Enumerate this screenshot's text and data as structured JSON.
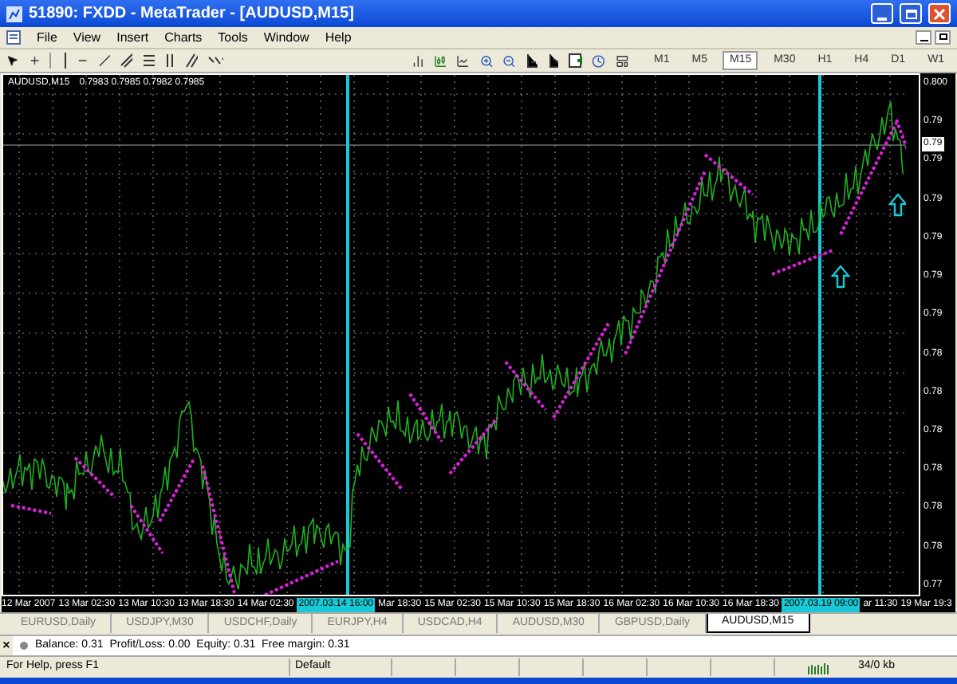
{
  "window": {
    "title": "51890: FXDD - MetaTrader - [AUDUSD,M15]"
  },
  "menu": [
    "File",
    "View",
    "Insert",
    "Charts",
    "Tools",
    "Window",
    "Help"
  ],
  "timeframes": [
    {
      "label": "M1",
      "selected": false
    },
    {
      "label": "M5",
      "selected": false
    },
    {
      "label": "M15",
      "selected": true
    },
    {
      "label": "M30",
      "selected": false
    },
    {
      "label": "H1",
      "selected": false
    },
    {
      "label": "H4",
      "selected": false
    },
    {
      "label": "D1",
      "selected": false
    },
    {
      "label": "W1",
      "selected": false
    }
  ],
  "chart": {
    "symbol": "AUDUSD,M15",
    "quotes": "0.7983 0.7985 0.7982 0.7985",
    "current_price": "0.79",
    "price_axis": [
      "0.800",
      "0.79",
      "0.79",
      "0.79",
      "0.79",
      "0.79",
      "0.79",
      "0.78",
      "0.78",
      "0.78",
      "0.78",
      "0.78",
      "0.78",
      "0.77"
    ],
    "time_axis": [
      {
        "label": "12 Mar 2007",
        "highlighted": false
      },
      {
        "label": "13 Mar 02:30",
        "highlighted": false
      },
      {
        "label": "13 Mar 10:30",
        "highlighted": false
      },
      {
        "label": "13 Mar 18:30",
        "highlighted": false
      },
      {
        "label": "14 Mar 02:30",
        "highlighted": false
      },
      {
        "label": "2007.03.14 16:00",
        "highlighted": true
      },
      {
        "label": "Mar 18:30",
        "highlighted": false
      },
      {
        "label": "15 Mar 02:30",
        "highlighted": false
      },
      {
        "label": "15 Mar 10:30",
        "highlighted": false
      },
      {
        "label": "15 Mar 18:30",
        "highlighted": false
      },
      {
        "label": "16 Mar 02:30",
        "highlighted": false
      },
      {
        "label": "16 Mar 10:30",
        "highlighted": false
      },
      {
        "label": "16 Mar 18:30",
        "highlighted": false
      },
      {
        "label": "2007.03.19 09:00",
        "highlighted": true
      },
      {
        "label": "ar 11:30",
        "highlighted": false
      },
      {
        "label": "19 Mar 19:3",
        "highlighted": false
      }
    ]
  },
  "tabs": [
    {
      "label": "EURUSD,Daily",
      "selected": false
    },
    {
      "label": "USDJPY,M30",
      "selected": false
    },
    {
      "label": "USDCHF,Daily",
      "selected": false
    },
    {
      "label": "EURJPY,H4",
      "selected": false
    },
    {
      "label": "USDCAD,H4",
      "selected": false
    },
    {
      "label": "AUDUSD,M30",
      "selected": false
    },
    {
      "label": "GBPUSD,Daily",
      "selected": false
    },
    {
      "label": "AUDUSD,M15",
      "selected": true
    }
  ],
  "terminal": {
    "close": "×",
    "account": "Balance: 0.31  Profit/Loss: 0.00  Equity: 0.31  Free margin: 0.31"
  },
  "status_bar": {
    "help": "For Help, press F1",
    "profile": "Default",
    "traffic": "34/0 kb"
  }
}
